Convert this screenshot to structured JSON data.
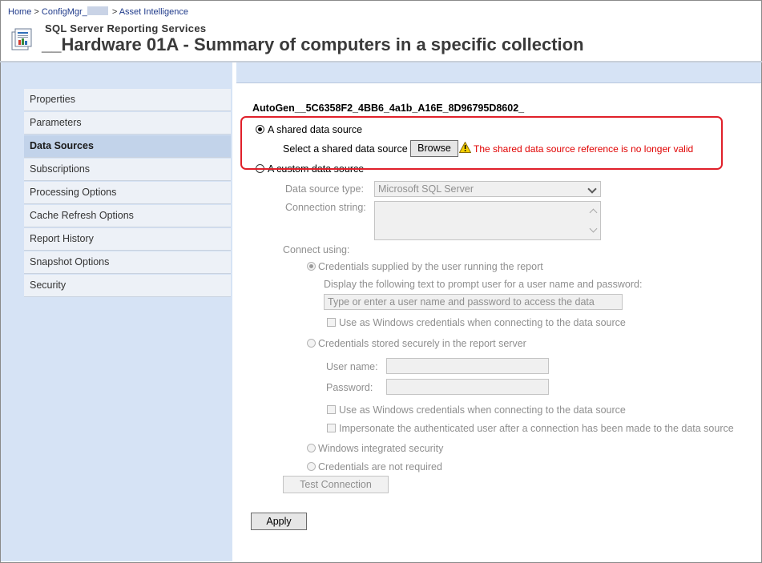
{
  "breadcrumb": {
    "home": "Home",
    "sep": ">",
    "site": "ConfigMgr_",
    "folder": "Asset Intelligence"
  },
  "header": {
    "app_title": "SQL Server Reporting Services",
    "page_title": "__Hardware 01A - Summary of computers in a specific collection"
  },
  "sidebar": {
    "items": [
      {
        "label": "Properties"
      },
      {
        "label": "Parameters"
      },
      {
        "label": "Data Sources"
      },
      {
        "label": "Subscriptions"
      },
      {
        "label": "Processing Options"
      },
      {
        "label": "Cache Refresh Options"
      },
      {
        "label": "Report History"
      },
      {
        "label": "Snapshot Options"
      },
      {
        "label": "Security"
      }
    ],
    "active": "Data Sources"
  },
  "main": {
    "datasource_name": "AutoGen__5C6358F2_4BB6_4a1b_A16E_8D96795D8602_",
    "shared_option_label": "A shared data source",
    "shared_select_label": "Select a shared data source",
    "browse_label": "Browse",
    "warning_text": "The shared data source reference is no longer valid",
    "custom_option_label": "A custom data source",
    "ds_type_label": "Data source type:",
    "ds_type_value": "Microsoft SQL Server",
    "conn_string_label": "Connection string:",
    "conn_string_value": "",
    "connect_using_label": "Connect using:",
    "cred_user_label": "Credentials supplied by the user running the report",
    "prompt_label": "Display the following text to prompt user for a user name and password:",
    "prompt_value": "Type or enter a user name and password to access the data source",
    "use_windows_label": "Use as Windows credentials when connecting to the data source",
    "cred_stored_label": "Credentials stored securely in the report server",
    "username_label": "User name:",
    "password_label": "Password:",
    "use_windows_label_2": "Use as Windows credentials when connecting to the data source",
    "impersonate_label": "Impersonate the authenticated user after a connection has been made to the data source",
    "windows_integrated_label": "Windows integrated security",
    "not_required_label": "Credentials are not required",
    "test_connection_label": "Test Connection",
    "apply_label": "Apply"
  },
  "colors": {
    "sidebar_bg": "#d6e3f5",
    "highlight_border": "#e0202a",
    "warning_text": "#e00000",
    "link": "#1f3a8a"
  }
}
